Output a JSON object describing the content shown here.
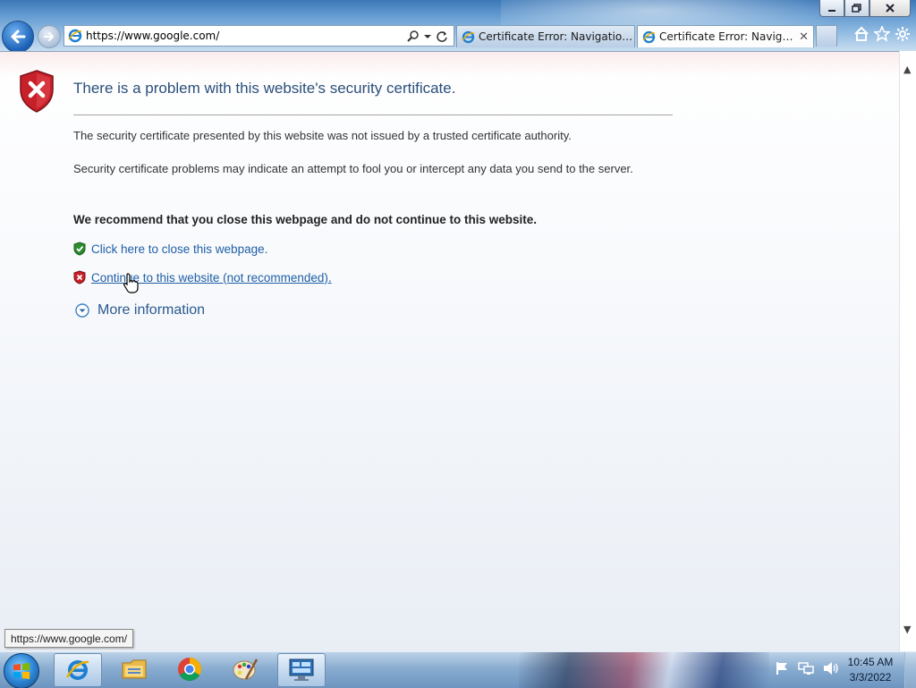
{
  "window": {
    "minimize_icon": "minimize-icon",
    "restore_icon": "restore-icon",
    "close_icon": "close-icon"
  },
  "nav": {
    "address_value": "https://www.google.com/",
    "back_icon": "back-arrow-icon",
    "forward_icon": "forward-arrow-icon",
    "search_icon": "search-icon",
    "dropdown_icon": "dropdown-icon",
    "refresh_icon": "refresh-icon"
  },
  "tabs": [
    {
      "label": "Certificate Error: Navigation Bl...",
      "active": false
    },
    {
      "label": "Certificate Error: Navigation...",
      "active": true,
      "close": "✕"
    }
  ],
  "commands": {
    "home_icon": "home-icon",
    "favorites_icon": "favorites-star-icon",
    "tools_icon": "gear-icon"
  },
  "page": {
    "title": "There is a problem with this website's security certificate.",
    "paragraph1": "The security certificate presented by this website was not issued by a trusted certificate authority.",
    "paragraph2": "Security certificate problems may indicate an attempt to fool you or intercept any data you send to the server.",
    "recommendation": "We recommend that you close this webpage and do not continue to this website.",
    "close_link": "Click here to close this webpage.",
    "continue_link": "Continue to this website (not recommended).",
    "more_info": "More information"
  },
  "status": {
    "url_tooltip": "https://www.google.com/"
  },
  "taskbar": {
    "items": [
      {
        "name": "internet-explorer",
        "active": true
      },
      {
        "name": "file-explorer",
        "active": false
      },
      {
        "name": "chrome",
        "active": false
      },
      {
        "name": "paint",
        "active": false
      },
      {
        "name": "remote-desktop",
        "active": false
      }
    ],
    "time": "10:45 AM",
    "date": "3/3/2022"
  },
  "colors": {
    "link": "#1f5fa5",
    "title": "#2a4f7a",
    "error_red": "#c8202a",
    "safe_green": "#2e8b2e"
  }
}
